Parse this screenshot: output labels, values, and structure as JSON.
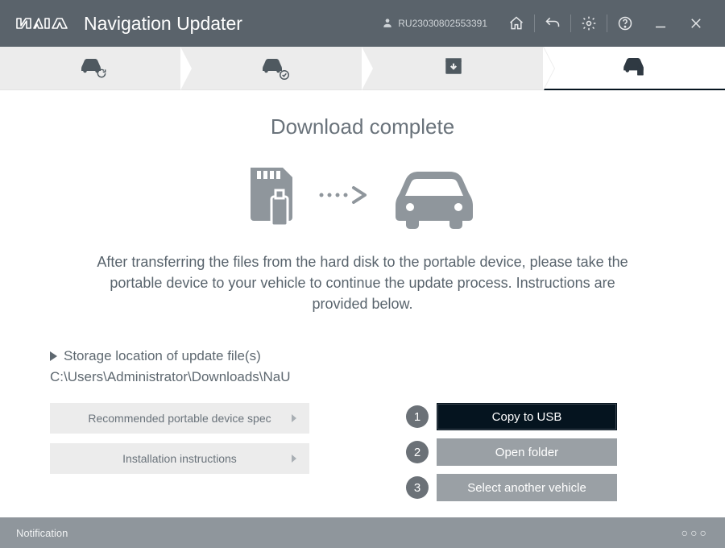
{
  "header": {
    "app_title": "Navigation Updater",
    "user_id": "RU23030802553391"
  },
  "main": {
    "headline": "Download complete",
    "instruction": "After transferring the files from the hard disk to the portable device, please take the portable device to your vehicle to continue the update process. Instructions are provided below.",
    "storage_label": "Storage location of update file(s)",
    "storage_path": "C:\\Users\\Administrator\\Downloads\\NaU",
    "links": {
      "spec": "Recommended portable device spec",
      "install": "Installation instructions"
    },
    "actions": {
      "copy": "Copy to USB",
      "open": "Open folder",
      "another": "Select another vehicle"
    },
    "action_nums": {
      "one": "1",
      "two": "2",
      "three": "3"
    }
  },
  "footer": {
    "label": "Notification"
  }
}
